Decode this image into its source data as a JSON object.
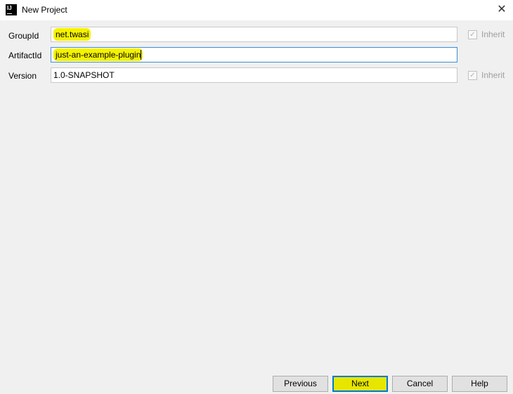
{
  "window": {
    "title": "New Project",
    "icon_text": "IJ"
  },
  "form": {
    "group_id": {
      "label": "GroupId",
      "value": "net.twasi",
      "inherit_label": "Inherit"
    },
    "artifact_id": {
      "label": "ArtifactId",
      "value": "just-an-example-plugin"
    },
    "version": {
      "label": "Version",
      "value": "1.0-SNAPSHOT",
      "inherit_label": "Inherit"
    }
  },
  "buttons": {
    "previous": "Previous",
    "next": "Next",
    "cancel": "Cancel",
    "help": "Help"
  }
}
